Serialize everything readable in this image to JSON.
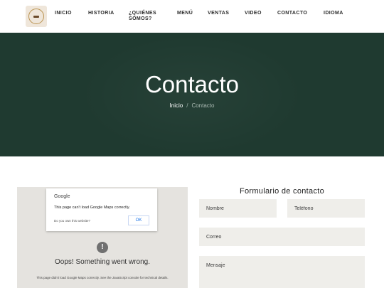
{
  "nav": {
    "logo_icon": "restaurant-seal-logo",
    "items": [
      {
        "label": "INICIO"
      },
      {
        "label": "HISTORIA"
      },
      {
        "label": "¿QUIÉNES"
      },
      {
        "label": "SOMOS?"
      },
      {
        "label": "MENÚ"
      },
      {
        "label": "VENTAS"
      },
      {
        "label": "VIDEO"
      },
      {
        "label": "CONTACTO"
      },
      {
        "label": "IDIOMA"
      }
    ]
  },
  "hero": {
    "title": "Contacto",
    "breadcrumb": {
      "home": "Inicio",
      "separator": "/",
      "current": "Contacto"
    },
    "background_color": "#1f3a30"
  },
  "map": {
    "dialog": {
      "brand": "Google",
      "message": "This page can't load Google Maps correctly.",
      "own_site_link": "Do you own this website?",
      "ok_label": "OK"
    },
    "error": {
      "icon": "exclamation-icon",
      "title": "Oops! Something went wrong.",
      "detail": "This page didn't load Google Maps correctly. See the JavaScript console for technical details."
    }
  },
  "form": {
    "title": "Formulario de contacto",
    "name_placeholder": "Nombre",
    "phone_placeholder": "Teléfono",
    "email_placeholder": "Correo",
    "message_placeholder": "Mensaje",
    "field_color": "#efeeea"
  }
}
